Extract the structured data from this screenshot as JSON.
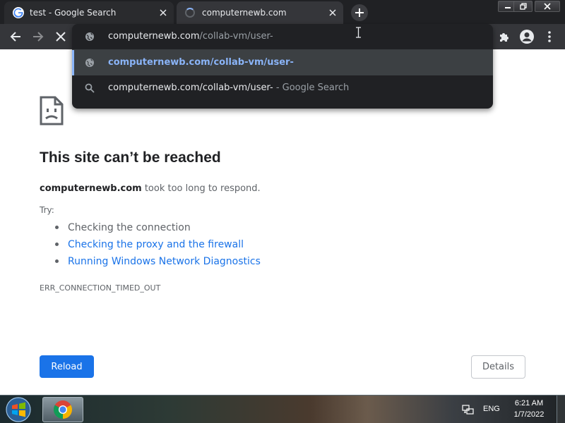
{
  "tabs": [
    {
      "title": "test - Google Search",
      "favicon": "google-g-icon",
      "state": "inactive"
    },
    {
      "title": "computernewb.com",
      "favicon": "loading-spinner-icon",
      "state": "active"
    }
  ],
  "toolbar": {
    "back_icon": "back-arrow-icon",
    "forward_icon": "forward-arrow-icon",
    "stop_icon": "stop-icon",
    "extensions_icon": "puzzle-piece-icon",
    "profile_icon": "account-circle-icon",
    "menu_icon": "kebab-menu-icon"
  },
  "omnibox": {
    "input_host": "computernewb.com",
    "input_path": "/collab-vm/user-",
    "suggestions": [
      {
        "text": "computernewb.com/collab-vm/user-",
        "suffix": "",
        "icon": "globe-icon",
        "selected": true
      },
      {
        "text": "computernewb.com/collab-vm/user-",
        "suffix": " - Google Search",
        "icon": "search-icon",
        "selected": false
      }
    ]
  },
  "page": {
    "title": "This site can’t be reached",
    "host": "computernewb.com",
    "description": " took too long to respond.",
    "try_label": "Try:",
    "suggestions": [
      {
        "text": "Checking the connection",
        "link": false
      },
      {
        "text": "Checking the proxy and the firewall",
        "link": true
      },
      {
        "text": "Running Windows Network Diagnostics",
        "link": true
      }
    ],
    "error_code": "ERR_CONNECTION_TIMED_OUT",
    "reload_label": "Reload",
    "details_label": "Details"
  },
  "taskbar": {
    "language": "ENG",
    "time": "6:21 AM",
    "date": "1/7/2022"
  },
  "colors": {
    "accent_blue": "#1a73e8",
    "omnibox_highlight": "#8ab4f8",
    "chrome_dark": "#35363a"
  }
}
